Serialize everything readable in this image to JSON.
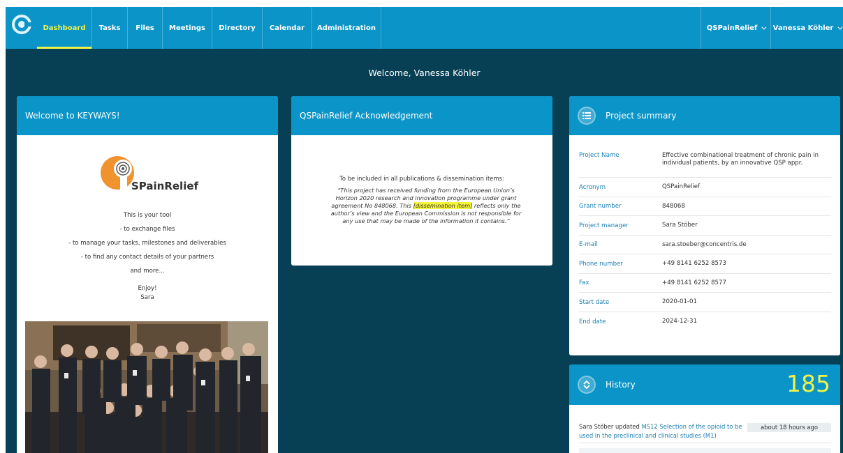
{
  "nav": {
    "items": [
      "Dashboard",
      "Tasks",
      "Files",
      "Meetings",
      "Directory",
      "Calendar",
      "Administration"
    ],
    "project_menu": "QSPainRelief",
    "user_menu": "Vanessa Köhler"
  },
  "welcome_title": "Welcome, Vanessa Köhler",
  "welcome_card": {
    "title": "Welcome to KEYWAYS!",
    "logo_text": "SPainRelief",
    "lines": [
      "This is your tool",
      "- to exchange files",
      "- to manage your tasks, milestones and deliverables",
      "- to find any contact details of your partners",
      "and more...",
      "Enjoy!",
      "Sara"
    ]
  },
  "ack_card": {
    "title": "QSPainRelief Acknowledgement",
    "intro": "To be included in all publications & dissemination items:",
    "quote_part1": "“This project has received funding from the European Union’s Horizon 2020 research and innovation programme under grant agreement No 848068. This ",
    "quote_highlight": "[dissemination item]",
    "quote_part2": " reflects only the author’s view and the European Commission is not responsible for any use that may be made of the information it contains.”"
  },
  "summary": {
    "title": "Project summary",
    "rows": [
      {
        "key": "Project Name",
        "value": "Effective combinational treatment of chronic pain in individual patients, by an innovative QSP appr."
      },
      {
        "key": "Acronym",
        "value": "QSPainRelief"
      },
      {
        "key": "Grant number",
        "value": "848068"
      },
      {
        "key": "Project manager",
        "value": "Sara Stöber"
      },
      {
        "key": "E-mail",
        "value": "sara.stoeber@concentris.de"
      },
      {
        "key": "Phone number",
        "value": "+49 8141 6252 8573"
      },
      {
        "key": "Fax",
        "value": "+49 8141 6252 8577"
      },
      {
        "key": "Start date",
        "value": "2020-01-01"
      },
      {
        "key": "End date",
        "value": "2024-12-31"
      }
    ]
  },
  "history": {
    "title": "History",
    "count": "185",
    "entry": {
      "user": "Sara Stöber",
      "action": " updated ",
      "link": "MS12 Selection of the opioid to be used in the preclinical and clinical studies (M1)",
      "time": "about 18 hours ago"
    }
  },
  "colors": {
    "nav_bg": "#0b94c7",
    "page_bg": "#073f54",
    "accent": "#eef24a",
    "link": "#1b7fb5"
  }
}
